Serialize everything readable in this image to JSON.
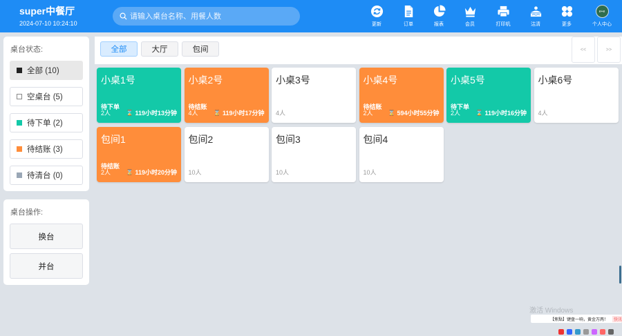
{
  "header": {
    "title": "super中餐厅",
    "datetime": "2024-07-10 10:24:10",
    "search_placeholder": "请输入桌台名称、用餐人数",
    "avatar_text": "e+e",
    "toolbar": [
      {
        "label": "更新",
        "icon": "refresh-icon"
      },
      {
        "label": "订单",
        "icon": "document-icon"
      },
      {
        "label": "报表",
        "icon": "pie-chart-icon"
      },
      {
        "label": "会员",
        "icon": "crown-icon"
      },
      {
        "label": "打印机",
        "icon": "printer-icon"
      },
      {
        "label": "沽清",
        "icon": "sell-out-icon"
      },
      {
        "label": "更多",
        "icon": "grid-more-icon"
      },
      {
        "label": "个人中心",
        "icon": "avatar-icon"
      }
    ]
  },
  "status_panel": {
    "title": "桌台状态:",
    "filters": [
      {
        "label": "全部 (10)",
        "color": "#222222",
        "active": true
      },
      {
        "label": "空桌台 (5)",
        "color": "#ffffff",
        "active": false
      },
      {
        "label": "待下单 (2)",
        "color": "#13c9a8",
        "active": false
      },
      {
        "label": "待结账 (3)",
        "color": "#ff8d3a",
        "active": false
      },
      {
        "label": "待清台 (0)",
        "color": "#9aa7b6",
        "active": false
      }
    ]
  },
  "ops_panel": {
    "title": "桌台操作:",
    "buttons": [
      "换台",
      "并台"
    ]
  },
  "area_tabs": [
    {
      "label": "全部",
      "active": true
    },
    {
      "label": "大厅",
      "active": false
    },
    {
      "label": "包间",
      "active": false
    }
  ],
  "pager": {
    "prev": "<<",
    "next": ">>"
  },
  "colors": {
    "primary": "#1e8cf5",
    "waiting_order": "#13c9a8",
    "waiting_checkout": "#ff8d3a"
  },
  "tables": [
    {
      "name": "小桌1号",
      "status": "待下单",
      "people": "2人",
      "duration": "119小时13分钟",
      "color": "#13c9a8"
    },
    {
      "name": "小桌2号",
      "status": "待结账",
      "people": "4人",
      "duration": "119小时17分钟",
      "color": "#ff8d3a"
    },
    {
      "name": "小桌3号",
      "status": "",
      "people": "4人",
      "duration": "",
      "color": ""
    },
    {
      "name": "小桌4号",
      "status": "待结账",
      "people": "2人",
      "duration": "594小时55分钟",
      "color": "#ff8d3a"
    },
    {
      "name": "小桌5号",
      "status": "待下单",
      "people": "2人",
      "duration": "119小时16分钟",
      "color": "#13c9a8"
    },
    {
      "name": "小桌6号",
      "status": "",
      "people": "4人",
      "duration": "",
      "color": ""
    },
    {
      "name": "包间1",
      "status": "待结账",
      "people": "2人",
      "duration": "119小时20分钟",
      "color": "#ff8d3a"
    },
    {
      "name": "包间2",
      "status": "",
      "people": "10人",
      "duration": "",
      "color": ""
    },
    {
      "name": "包间3",
      "status": "",
      "people": "10人",
      "duration": "",
      "color": ""
    },
    {
      "name": "包间4",
      "status": "",
      "people": "10人",
      "duration": "",
      "color": ""
    }
  ],
  "overlay": {
    "watermark": "激活 Windows",
    "news": "【焦點】键盘一响，黄金万两！",
    "news_tag": "快讯"
  }
}
